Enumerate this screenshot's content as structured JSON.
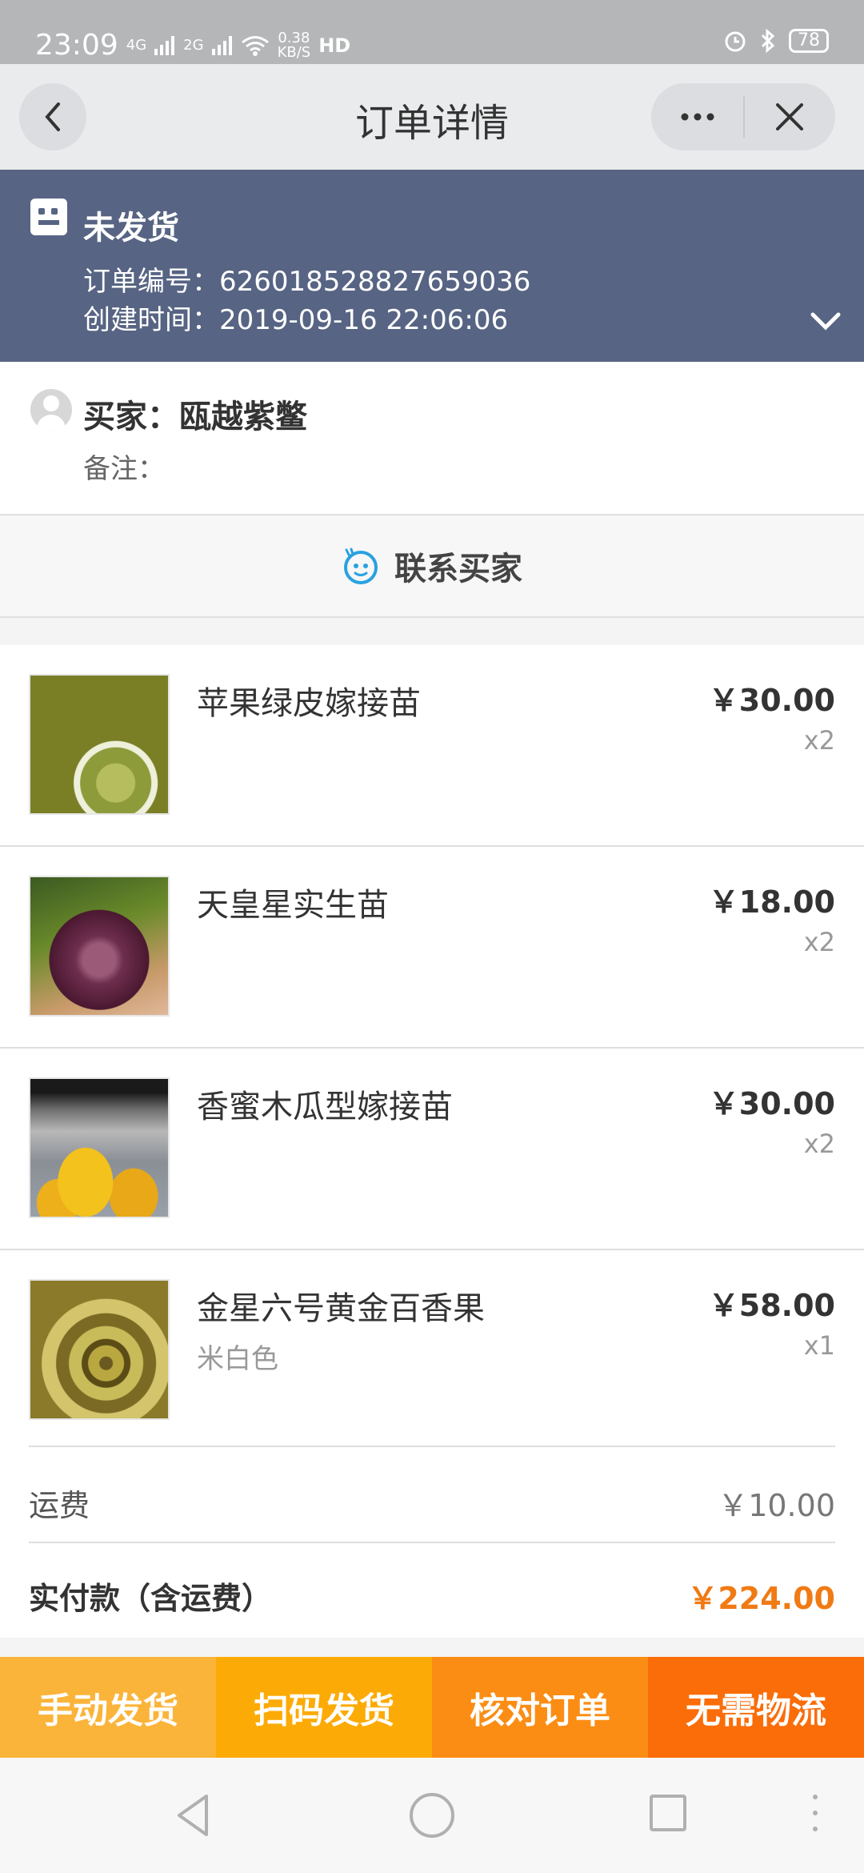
{
  "status_bar": {
    "time": "23:09",
    "network_1": "4G",
    "network_2": "2G",
    "speed_value": "0.38",
    "speed_unit": "KB/S",
    "hd": "HD",
    "battery": "78"
  },
  "header": {
    "title": "订单详情"
  },
  "order_status": {
    "title": "未发货",
    "order_no": "订单编号：626018528827659036",
    "created": "创建时间：2019-09-16 22:06:06"
  },
  "buyer": {
    "name": "买家：瓯越紫鳖",
    "remark": "备注："
  },
  "contact": {
    "label": "联系买家"
  },
  "goods": [
    {
      "name": "苹果绿皮嫁接苗",
      "spec": "",
      "price": "￥30.00",
      "qty": "x2"
    },
    {
      "name": "天皇星实生苗",
      "spec": "",
      "price": "￥18.00",
      "qty": "x2"
    },
    {
      "name": "香蜜木瓜型嫁接苗",
      "spec": "",
      "price": "￥30.00",
      "qty": "x2"
    },
    {
      "name": "金星六号黄金百香果",
      "spec": "米白色",
      "price": "￥58.00",
      "qty": "x1"
    }
  ],
  "summary": {
    "freight_label": "运费",
    "freight_value": "￥10.00",
    "total_label": "实付款（含运费）",
    "total_value": "￥224.00"
  },
  "actions": {
    "manual_ship": "手动发货",
    "scan_ship": "扫码发货",
    "verify_order": "核对订单",
    "no_logistics": "无需物流"
  },
  "colors": {
    "status_panel_bg": "#576483",
    "price_accent": "#f07a14",
    "action_1": "#fbb43a",
    "action_2": "#fcab06",
    "action_3": "#fb8d15",
    "action_4": "#fa6d09"
  }
}
